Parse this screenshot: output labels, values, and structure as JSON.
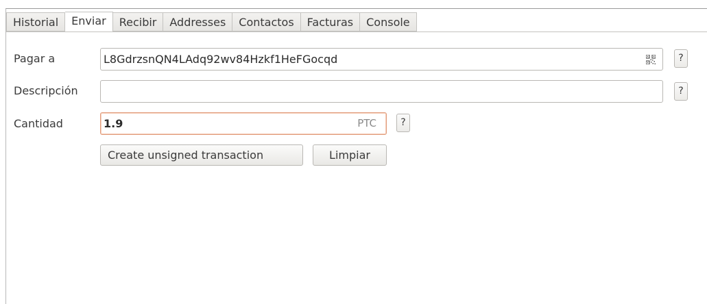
{
  "tabs": [
    {
      "label": "Historial"
    },
    {
      "label": "Enviar"
    },
    {
      "label": "Recibir"
    },
    {
      "label": "Addresses"
    },
    {
      "label": "Contactos"
    },
    {
      "label": "Facturas"
    },
    {
      "label": "Console"
    }
  ],
  "active_tab": "Enviar",
  "form": {
    "pay_to": {
      "label": "Pagar a",
      "value": "L8GdrzsnQN4LAdq92wv84Hzkf1HeFGocqd",
      "help": "?"
    },
    "description": {
      "label": "Descripción",
      "value": "",
      "help": "?"
    },
    "amount": {
      "label": "Cantidad",
      "value": "1.9",
      "unit": "PTC",
      "help": "?"
    }
  },
  "buttons": {
    "create_unsigned": "Create unsigned transaction",
    "clear": "Limpiar"
  },
  "icons": {
    "qr": "qr-code-icon"
  },
  "colors": {
    "focus_border": "#e09b7b",
    "border": "#b9b7b3"
  }
}
